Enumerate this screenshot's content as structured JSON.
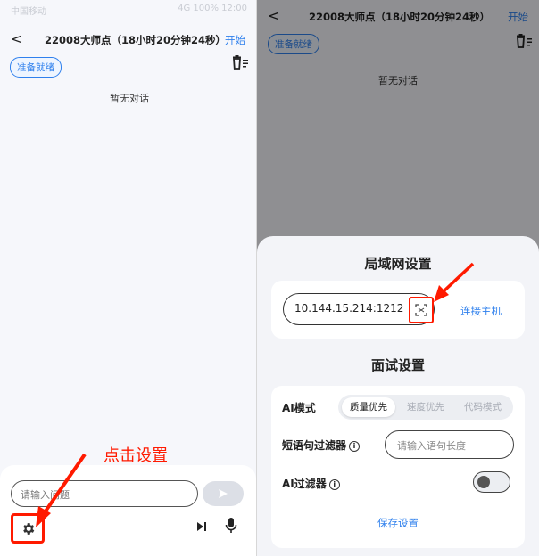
{
  "left": {
    "statusbar": {
      "left": "中国移动",
      "right": "4G 100% 12:00"
    },
    "header": {
      "back": "<",
      "title": "22008大师点（18小时20分钟24秒）",
      "start": "开始"
    },
    "ready_badge": "准备就绪",
    "empty_text": "暂无对话",
    "annotation": "点击设置",
    "input_placeholder": "请输入问题",
    "icons": [
      "back-icon",
      "trash-list-icon",
      "send-icon",
      "gear-icon",
      "skip-icon",
      "mic-icon"
    ]
  },
  "right": {
    "header": {
      "back": "<",
      "title": "22008大师点（18小时20分钟24秒）",
      "start": "开始"
    },
    "ready_badge": "准备就绪",
    "empty_text": "暂无对话",
    "lan": {
      "title": "局域网设置",
      "ip_value": "10.144.15.214:1212",
      "connect": "连接主机"
    },
    "interview": {
      "title": "面试设置",
      "ai_mode_label": "AI模式",
      "modes": [
        "质量优先",
        "速度优先",
        "代码模式"
      ],
      "selected_mode": "质量优先",
      "short_filter_label": "短语句过滤器",
      "length_placeholder": "请输入语句长度",
      "ai_filter_label": "AI过滤器",
      "ai_filter_on": false,
      "save": "保存设置"
    }
  },
  "colors": {
    "accent": "#2f80ed",
    "annotation": "#ff1a00",
    "background": "#f6f7fb"
  }
}
